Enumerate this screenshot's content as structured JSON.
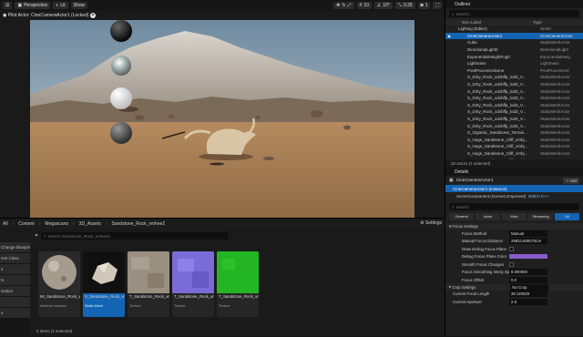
{
  "viewport": {
    "perspective": "Perspective",
    "lit": "Lit",
    "show": "Show",
    "pilot_text": "Pilot Actor: CineCameraActor1 (Locked)",
    "grid_snap": "10",
    "angle_snap": "10°",
    "scale_snap": "0.25",
    "cam_speed": "1"
  },
  "outliner": {
    "title": "Outliner",
    "search_placeholder": "Search...",
    "col_label": "Item Label",
    "col_type": "Type",
    "rows": [
      {
        "label": "Lighting (Editor)",
        "type": "World",
        "indent": 0,
        "selected": false
      },
      {
        "label": "CineCameraActor1",
        "type": "CineCameraActor",
        "indent": 1,
        "selected": true
      },
      {
        "label": "Cube",
        "type": "StaticMeshActor",
        "indent": 1,
        "selected": false
      },
      {
        "label": "DirectionalLight0",
        "type": "DirectionalLight",
        "indent": 1,
        "selected": false
      },
      {
        "label": "ExponentialHeightFog0",
        "type": "ExponentialHeig",
        "indent": 1,
        "selected": false
      },
      {
        "label": "Lightmass",
        "type": "Lightmass",
        "indent": 1,
        "selected": false
      },
      {
        "label": "PostProcessVolume",
        "type": "PostProcessVol",
        "indent": 1,
        "selected": false
      },
      {
        "label": "S_Dirty_Rock_xdxhffp_lod3_V...",
        "type": "StaticMeshActor",
        "indent": 1,
        "selected": false
      },
      {
        "label": "S_Dirty_Rock_xdxhffp_lod3_V...",
        "type": "StaticMeshActor",
        "indent": 1,
        "selected": false
      },
      {
        "label": "S_Dirty_Rock_xdxhffp_lod3_V...",
        "type": "StaticMeshActor",
        "indent": 1,
        "selected": false
      },
      {
        "label": "S_Dirty_Rock_xdxhffp_lod3_V...",
        "type": "StaticMeshActor",
        "indent": 1,
        "selected": false
      },
      {
        "label": "S_Dirty_Rock_xdxhffp_lod3_V...",
        "type": "StaticMeshActor",
        "indent": 1,
        "selected": false
      },
      {
        "label": "S_Dirty_Rock_xdxhffp_lod3_V...",
        "type": "StaticMeshActor",
        "indent": 1,
        "selected": false
      },
      {
        "label": "S_Dirty_Rock_xdxhffp_lod3_V...",
        "type": "StaticMeshActor",
        "indent": 1,
        "selected": false
      },
      {
        "label": "S_Dirty_Rock_xdxhffp_lod3_V...",
        "type": "StaticMeshActor",
        "indent": 1,
        "selected": false
      },
      {
        "label": "S_Gigantic_Sandstone_Terrain...",
        "type": "StaticMeshActor",
        "indent": 1,
        "selected": false
      },
      {
        "label": "S_Huge_Sandstone_Cliff_vmhj...",
        "type": "StaticMeshActor",
        "indent": 1,
        "selected": false
      },
      {
        "label": "S_Huge_Sandstone_Cliff_vmhj...",
        "type": "StaticMeshActor",
        "indent": 1,
        "selected": false
      },
      {
        "label": "S_Huge_Sandstone_Cliff_vmhj...",
        "type": "StaticMeshActor",
        "indent": 1,
        "selected": false
      },
      {
        "label": "S_Huge_Sandstone_Cliff_vmhj...",
        "type": "StaticMeshActor",
        "indent": 1,
        "selected": false
      },
      {
        "label": "S_Huge_Sandstone_Cliff_vmhj...",
        "type": "StaticMeshActor",
        "indent": 1,
        "selected": false
      }
    ],
    "footer": "32 actors (1 selected)"
  },
  "details": {
    "title": "Details",
    "actor_name": "CineCameraActor1",
    "add_label": "+ Add",
    "instance_label": "CineCameraActor1 (Instance)",
    "scene_component": "SceneComponent (SceneComponent)",
    "edit_cpp": "Edit in C++",
    "search_placeholder": "Search",
    "tabs": [
      "General",
      "Actor",
      "Misc",
      "Streaming",
      "All"
    ],
    "focus_section": "Focus Settings",
    "rows": [
      {
        "label": "Focus Method",
        "value": "Manual",
        "kind": "select"
      },
      {
        "label": "Manual Focus Distance",
        "value": "29824.609375cm",
        "kind": "num"
      },
      {
        "label": "Draw Debug Focus Plane",
        "value": "",
        "kind": "check"
      },
      {
        "label": "Debug Focus Plane Color",
        "value": "",
        "kind": "color"
      },
      {
        "label": "Smooth Focus Changes",
        "value": "",
        "kind": "check"
      },
      {
        "label": "Focus Smoothing Interp Speed",
        "value": "8.000000",
        "kind": "num"
      },
      {
        "label": "Focus Offset",
        "value": "0.0",
        "kind": "num"
      }
    ],
    "crop_section": "Crop Settings",
    "crop_value": "No Crop",
    "current_focal_label": "Current Focal Length",
    "current_focal_value": "38.119029",
    "current_aperture_label": "Current Aperture",
    "current_aperture_value": "2.8"
  },
  "content": {
    "crumbs": [
      "All",
      "Content",
      "Megascans",
      "3D_Assets",
      "Sandstone_Rock_vmhee2"
    ],
    "settings": "Settings",
    "search_placeholder": "Search Sandstone_Rock_vmhee2",
    "side_items": [
      "Change Blueprint",
      "Get Class",
      "s",
      "ts",
      "ization",
      "",
      "s"
    ],
    "tiles": [
      {
        "name": "MI_Sandstone_Rock_vmhee2_2K",
        "type": "Material Instance",
        "selected": false
      },
      {
        "name": "S_Sandstone_Rock_vmhee2_lod3_Var1",
        "type": "Static Mesh",
        "selected": true
      },
      {
        "name": "T_Sandstone_Rock_vmhee2_2K_D",
        "type": "Texture",
        "selected": false
      },
      {
        "name": "T_Sandstone_Rock_vmhee2_2K_N",
        "type": "Texture",
        "selected": false
      },
      {
        "name": "T_Sandstone_Rock_vmhee2_2K_Dp8",
        "type": "Texture",
        "selected": false
      }
    ],
    "status": "5 items (1 selected)"
  }
}
